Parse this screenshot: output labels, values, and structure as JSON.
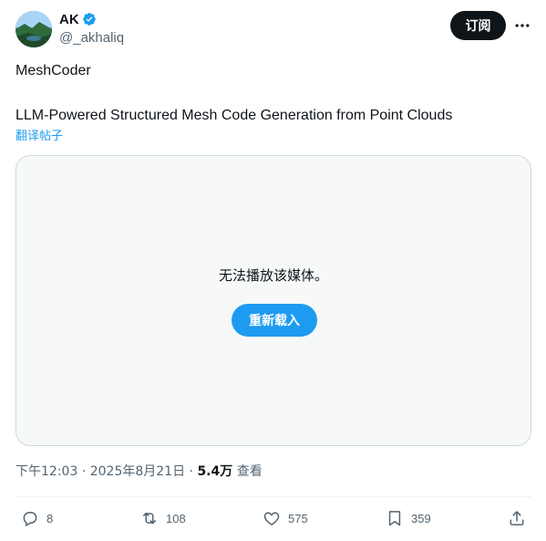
{
  "author": {
    "display_name": "AK",
    "handle": "@_akhaliq",
    "verified": true
  },
  "header": {
    "subscribe_label": "订阅",
    "more_icon": "more-horizontal-icon"
  },
  "tweet": {
    "line1": "MeshCoder",
    "line2": "LLM-Powered Structured Mesh Code Generation from Point Clouds",
    "translate_label": "翻译帖子"
  },
  "media": {
    "message": "无法播放该媒体。",
    "reload_label": "重新载入"
  },
  "meta": {
    "time": "下午12:03",
    "date": "2025年8月21日",
    "views_count": "5.4万",
    "views_label": "查看"
  },
  "actions": {
    "replies": "8",
    "retweets": "108",
    "likes": "575",
    "bookmarks": "359"
  },
  "colors": {
    "accent": "#1d9bf0",
    "text_primary": "#0f1419",
    "text_secondary": "#536471"
  }
}
